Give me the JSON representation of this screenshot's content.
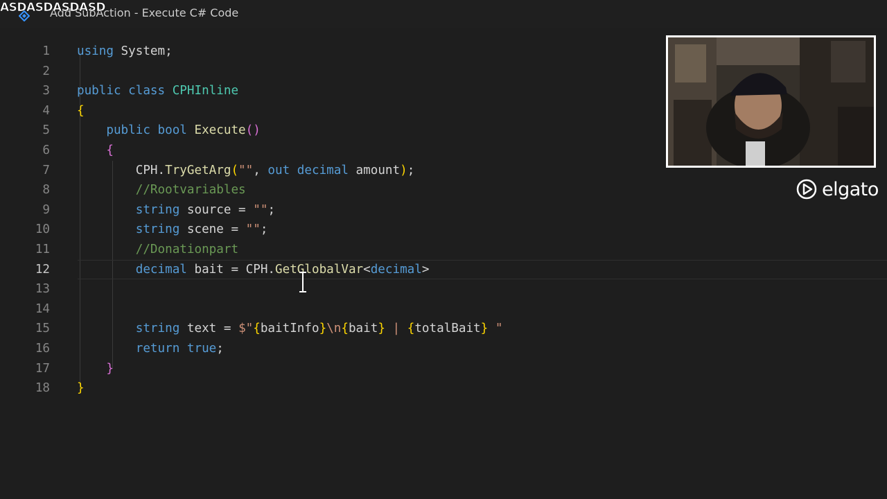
{
  "overlay": {
    "tag": "ASDASDASDASD"
  },
  "window": {
    "title": "Add SubAction - Execute C# Code"
  },
  "editor": {
    "current_line": 12,
    "lines": [
      {
        "num": "1",
        "tokens": [
          [
            "using",
            "kw"
          ],
          [
            " System;",
            "pl"
          ]
        ]
      },
      {
        "num": "2",
        "tokens": []
      },
      {
        "num": "3",
        "tokens": [
          [
            "public",
            "kw"
          ],
          [
            " ",
            "pl"
          ],
          [
            "class",
            "kw"
          ],
          [
            " CPHInline",
            "ty"
          ]
        ]
      },
      {
        "num": "4",
        "tokens": [
          [
            "{",
            "br1"
          ]
        ]
      },
      {
        "num": "5",
        "tokens": [
          [
            "    ",
            "pl"
          ],
          [
            "public",
            "kw"
          ],
          [
            " ",
            "pl"
          ],
          [
            "bool",
            "kw"
          ],
          [
            " ",
            "pl"
          ],
          [
            "Execute",
            "fn"
          ],
          [
            "()",
            "br2"
          ]
        ]
      },
      {
        "num": "6",
        "tokens": [
          [
            "    ",
            "pl"
          ],
          [
            "{",
            "br2"
          ]
        ]
      },
      {
        "num": "7",
        "tokens": [
          [
            "        CPH.",
            "pl"
          ],
          [
            "TryGetArg",
            "fn"
          ],
          [
            "(",
            "br1"
          ],
          [
            "\"\"",
            "st"
          ],
          [
            ", ",
            "pl"
          ],
          [
            "out",
            "kw"
          ],
          [
            " ",
            "pl"
          ],
          [
            "decimal",
            "kw"
          ],
          [
            " amount",
            "pl"
          ],
          [
            ")",
            "br1"
          ],
          [
            ";",
            "pl"
          ]
        ]
      },
      {
        "num": "8",
        "tokens": [
          [
            "        ",
            "pl"
          ],
          [
            "//Rootvariables",
            "cm"
          ]
        ]
      },
      {
        "num": "9",
        "tokens": [
          [
            "        ",
            "pl"
          ],
          [
            "string",
            "kw"
          ],
          [
            " source = ",
            "pl"
          ],
          [
            "\"\"",
            "st"
          ],
          [
            ";",
            "pl"
          ]
        ]
      },
      {
        "num": "10",
        "tokens": [
          [
            "        ",
            "pl"
          ],
          [
            "string",
            "kw"
          ],
          [
            " scene = ",
            "pl"
          ],
          [
            "\"\"",
            "st"
          ],
          [
            ";",
            "pl"
          ]
        ]
      },
      {
        "num": "11",
        "tokens": [
          [
            "        ",
            "pl"
          ],
          [
            "//Donationpart",
            "cm"
          ]
        ]
      },
      {
        "num": "12",
        "tokens": [
          [
            "        ",
            "pl"
          ],
          [
            "decimal",
            "kw"
          ],
          [
            " bait = CPH.",
            "pl"
          ],
          [
            "GetGlobalVar",
            "fn"
          ],
          [
            "<",
            "pl"
          ],
          [
            "decimal",
            "kw"
          ],
          [
            ">",
            "pl"
          ]
        ]
      },
      {
        "num": "13",
        "tokens": []
      },
      {
        "num": "14",
        "tokens": []
      },
      {
        "num": "15",
        "tokens": [
          [
            "        ",
            "pl"
          ],
          [
            "string",
            "kw"
          ],
          [
            " text = ",
            "pl"
          ],
          [
            "$\"",
            "st"
          ],
          [
            "{",
            "br1"
          ],
          [
            "baitInfo",
            "pl"
          ],
          [
            "}",
            "br1"
          ],
          [
            "\\n",
            "st"
          ],
          [
            "{",
            "br1"
          ],
          [
            "bait",
            "pl"
          ],
          [
            "}",
            "br1"
          ],
          [
            " | ",
            "st"
          ],
          [
            "{",
            "br1"
          ],
          [
            "totalBait",
            "pl"
          ],
          [
            "}",
            "br1"
          ],
          [
            " \"",
            "st"
          ]
        ]
      },
      {
        "num": "16",
        "tokens": [
          [
            "        ",
            "pl"
          ],
          [
            "return",
            "kw"
          ],
          [
            " ",
            "pl"
          ],
          [
            "true",
            "kw"
          ],
          [
            ";",
            "pl"
          ]
        ]
      },
      {
        "num": "17",
        "tokens": [
          [
            "    ",
            "pl"
          ],
          [
            "}",
            "br2"
          ]
        ]
      },
      {
        "num": "18",
        "tokens": [
          [
            "}",
            "br1"
          ]
        ]
      }
    ]
  },
  "webcam": {
    "label": "webcam feed"
  },
  "branding": {
    "logo_text": "elgato"
  },
  "colors": {
    "background": "#1e1e1e",
    "keyword": "#569cd6",
    "type": "#4ec9b0",
    "function": "#dcdcaa",
    "string": "#ce9178",
    "comment": "#6a9955",
    "bracket_gold": "#ffd700",
    "bracket_purple": "#da70d6"
  }
}
